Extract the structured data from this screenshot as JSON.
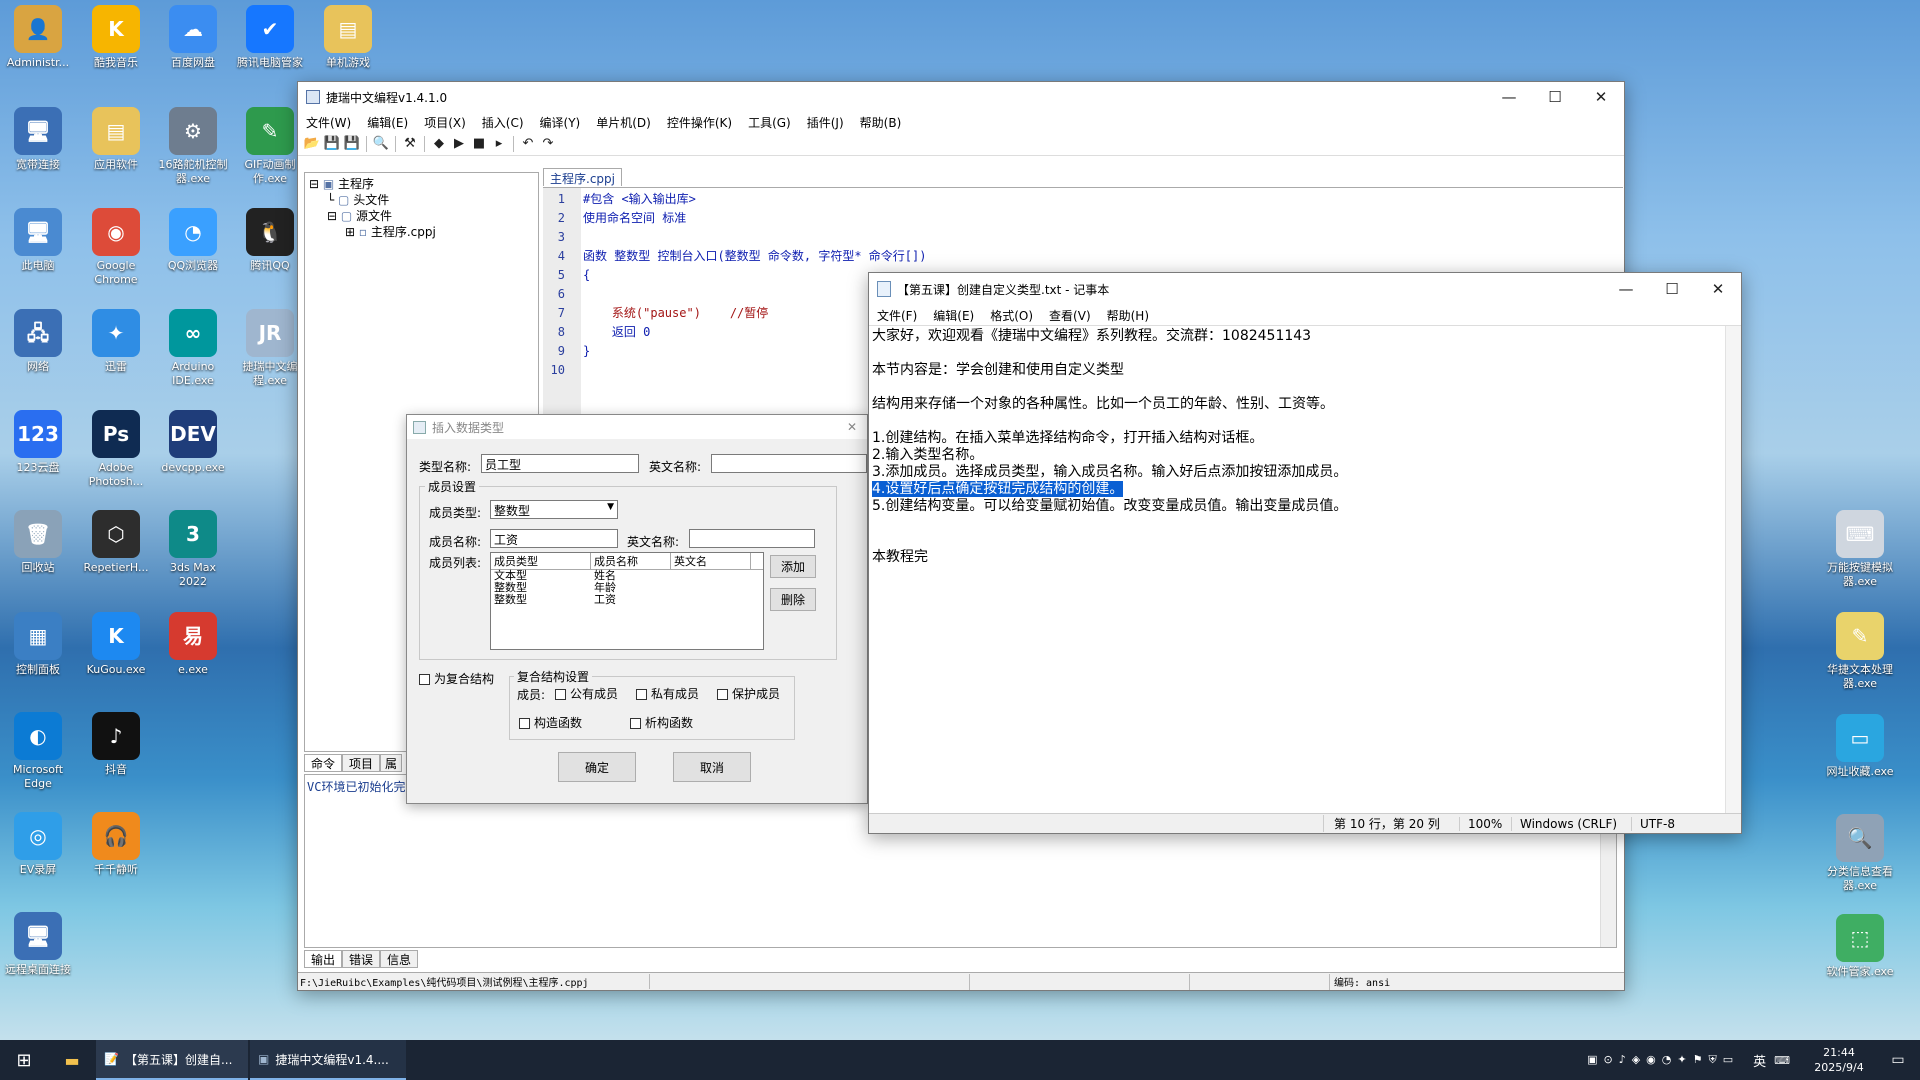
{
  "desktop": {
    "icons": [
      {
        "label": "Administr...",
        "symbol": "👤",
        "color": "#d9a441"
      },
      {
        "label": "酷我音乐",
        "symbol": "K",
        "color": "#f7b500"
      },
      {
        "label": "百度网盘",
        "symbol": "☁",
        "color": "#3b8df1"
      },
      {
        "label": "腾讯电脑管家",
        "symbol": "✔",
        "color": "#1677ff"
      },
      {
        "label": "单机游戏",
        "symbol": "▤",
        "color": "#e8c35b"
      },
      {
        "label": "宽带连接",
        "symbol": "🖥",
        "color": "#3b6fb5"
      },
      {
        "label": "应用软件",
        "symbol": "▤",
        "color": "#e8c35b"
      },
      {
        "label": "16路舵机控制器.exe",
        "symbol": "⚙",
        "color": "#6e7d8f"
      },
      {
        "label": "GIF动画制作.exe",
        "symbol": "✎",
        "color": "#2e9a4d"
      },
      {
        "label": "此电脑",
        "symbol": "🖥",
        "color": "#4a8ad1"
      },
      {
        "label": "Google Chrome",
        "symbol": "◉",
        "color": "#dd4b39"
      },
      {
        "label": "QQ浏览器",
        "symbol": "◔",
        "color": "#3aa0ff"
      },
      {
        "label": "腾讯QQ",
        "symbol": "🐧",
        "color": "#222"
      },
      {
        "label": "网络",
        "symbol": "🖧",
        "color": "#3b6fb5"
      },
      {
        "label": "迅雷",
        "symbol": "✦",
        "color": "#2f8de4"
      },
      {
        "label": "Arduino IDE.exe",
        "symbol": "∞",
        "color": "#00979d"
      },
      {
        "label": "捷瑞中文编程.exe",
        "symbol": "JR",
        "color": "#9fb6cf"
      },
      {
        "label": "123云盘",
        "symbol": "123",
        "color": "#2a6ef0"
      },
      {
        "label": "Adobe Photosh...",
        "symbol": "Ps",
        "color": "#0f2b52"
      },
      {
        "label": "devcpp.exe",
        "symbol": "DEV",
        "color": "#1f3d7a"
      },
      {
        "label": "回收站",
        "symbol": "🗑",
        "color": "#8aa2b8"
      },
      {
        "label": "RepetierH...",
        "symbol": "⬡",
        "color": "#2d2d2d"
      },
      {
        "label": "3ds Max 2022",
        "symbol": "3",
        "color": "#0e8a88"
      },
      {
        "label": "控制面板",
        "symbol": "▦",
        "color": "#3b7fc4"
      },
      {
        "label": "KuGou.exe",
        "symbol": "K",
        "color": "#1d89f1"
      },
      {
        "label": "e.exe",
        "symbol": "易",
        "color": "#d63a2f"
      },
      {
        "label": "Microsoft Edge",
        "symbol": "◐",
        "color": "#0c7bd4"
      },
      {
        "label": "抖音",
        "symbol": "♪",
        "color": "#111"
      },
      {
        "label": "EV录屏",
        "symbol": "◎",
        "color": "#2f9ee8"
      },
      {
        "label": "千千静听",
        "symbol": "🎧",
        "color": "#f08a1c"
      },
      {
        "label": "远程桌面连接",
        "symbol": "🖥",
        "color": "#3b6fb5"
      },
      {
        "label": "万能按键模拟器.exe",
        "symbol": "⌨",
        "color": "#cfd6df"
      },
      {
        "label": "华捷文本处理器.exe",
        "symbol": "✎",
        "color": "#e9d36b"
      },
      {
        "label": "网址收藏.exe",
        "symbol": "▭",
        "color": "#2aa6e0"
      },
      {
        "label": "分类信息查看器.exe",
        "symbol": "🔍",
        "color": "#8fa2b6"
      },
      {
        "label": "软件管家.exe",
        "symbol": "⬚",
        "color": "#3fae63"
      }
    ]
  },
  "ide": {
    "title": "捷瑞中文编程v1.4.1.0",
    "menu": [
      "文件(W)",
      "编辑(E)",
      "项目(X)",
      "插入(C)",
      "编译(Y)",
      "单片机(D)",
      "控件操作(K)",
      "工具(G)",
      "插件(J)",
      "帮助(B)"
    ],
    "tree": {
      "root": "主程序",
      "header": "头文件",
      "source": "源文件",
      "file": "主程序.cppj"
    },
    "tab": "主程序.cppj",
    "code": [
      {
        "n": "1",
        "t": "#包含 <输入输出库>"
      },
      {
        "n": "2",
        "t": "使用命名空间 标准"
      },
      {
        "n": "3",
        "t": ""
      },
      {
        "n": "4",
        "t": "函数 整数型 控制台入口(整数型 命令数, 字符型* 命令行[])"
      },
      {
        "n": "5",
        "t": "{"
      },
      {
        "n": "6",
        "t": ""
      },
      {
        "n": "7",
        "t": "    系统(\"pause\")    //暂停"
      },
      {
        "n": "8",
        "t": "    返回 0"
      },
      {
        "n": "9",
        "t": "}"
      },
      {
        "n": "10",
        "t": ""
      }
    ],
    "left_tabs": [
      "命令",
      "项目",
      "属"
    ],
    "output_text": "VC环境已初始化完",
    "bottom_tabs": [
      "输出",
      "错误",
      "信息"
    ],
    "status_path": "F:\\JieRuibc\\Examples\\纯代码项目\\测试例程\\主程序.cppj",
    "status_encoding": "编码: ansi"
  },
  "dialog": {
    "title": "插入数据类型",
    "type_name_label": "类型名称:",
    "type_name_value": "员工型",
    "en_name_label": "英文名称:",
    "member_settings": "成员设置",
    "member_type_label": "成员类型:",
    "member_type_value": "整数型",
    "member_name_label": "成员名称:",
    "member_name_value": "工资",
    "member_en_label": "英文名称:",
    "member_list_label": "成员列表:",
    "list_headers": [
      "成员类型",
      "成员名称",
      "英文名"
    ],
    "list_rows": [
      [
        "文本型",
        "姓名",
        ""
      ],
      [
        "整数型",
        "年龄",
        ""
      ],
      [
        "整数型",
        "工资",
        ""
      ]
    ],
    "add_btn": "添加",
    "delete_btn": "删除",
    "composite_check": "为复合结构",
    "composite_group": "复合结构设置",
    "members_label": "成员:",
    "public": "公有成员",
    "private": "私有成员",
    "protected": "保护成员",
    "ctor": "构造函数",
    "dtor": "析构函数",
    "ok": "确定",
    "cancel": "取消"
  },
  "notepad": {
    "title": "【第五课】创建自定义类型.txt - 记事本",
    "menu": [
      "文件(F)",
      "编辑(E)",
      "格式(O)",
      "查看(V)",
      "帮助(H)"
    ],
    "lines": [
      "大家好，欢迎观看《捷瑞中文编程》系列教程。交流群：1082451143",
      "",
      "本节内容是：学会创建和使用自定义类型",
      "",
      "结构用来存储一个对象的各种属性。比如一个员工的年龄、性别、工资等。",
      "",
      "1.创建结构。在插入菜单选择结构命令，打开插入结构对话框。",
      "2.输入类型名称。",
      "3.添加成员。选择成员类型，输入成员名称。输入好后点添加按钮添加成员。",
      "4.设置好后点确定按钮完成结构的创建。",
      "5.创建结构变量。可以给变量赋初始值。改变变量成员值。输出变量成员值。",
      "",
      "",
      "本教程完"
    ],
    "highlighted_line": "4.设置好后点确定按钮完成结构的创建。",
    "status": {
      "position": "第 10 行，第 20 列",
      "zoom": "100%",
      "eol": "Windows (CRLF)",
      "encoding": "UTF-8"
    }
  },
  "taskbar": {
    "tasks": [
      "【第五课】创建自...",
      "捷瑞中文编程v1.4...."
    ],
    "ime": "英",
    "time": "21:44",
    "date": "2025/9/4"
  }
}
